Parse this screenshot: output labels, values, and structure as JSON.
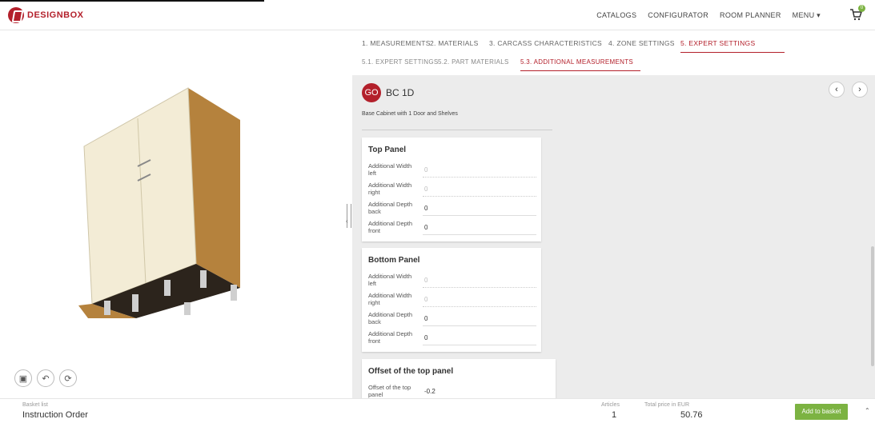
{
  "header": {
    "logo_text": "DESIGNBOX",
    "nav": [
      "CATALOGS",
      "CONFIGURATOR",
      "ROOM PLANNER",
      "MENU ▾"
    ],
    "cart_count": "0",
    "brand_color": "#b3202b"
  },
  "tabs_main": [
    "1. MEASUREMENTS",
    "2. MATERIALS",
    "3. CARCASS CHARACTERISTICS",
    "4. ZONE SETTINGS",
    "5. EXPERT SETTINGS"
  ],
  "tabs_sub": [
    "5.1. EXPERT SETTINGS",
    "5.2. PART MATERIALS",
    "5.3. ADDITIONAL MEASUREMENTS"
  ],
  "product": {
    "badge": "GO",
    "code": "BC 1D",
    "description": "Base Cabinet with 1 Door and Shelves"
  },
  "cards": {
    "top": {
      "title": "Top Panel",
      "rows": [
        {
          "label": "Additional Width left",
          "value": "0"
        },
        {
          "label": "Additional Width right",
          "value": "0"
        },
        {
          "label": "Additional Depth back",
          "value": "0"
        },
        {
          "label": "Additional Depth front",
          "value": "0"
        }
      ]
    },
    "bottom": {
      "title": "Bottom Panel",
      "rows": [
        {
          "label": "Additional Width left",
          "value": "0"
        },
        {
          "label": "Additional Width right",
          "value": "0"
        },
        {
          "label": "Additional Depth back",
          "value": "0"
        },
        {
          "label": "Additional Depth front",
          "value": "0"
        }
      ]
    },
    "offset": {
      "title": "Offset of the top panel",
      "rows": [
        {
          "label": "Offset of the top panel",
          "value": "-0.2"
        }
      ]
    }
  },
  "footer": {
    "basket_label": "Basket list",
    "basket_name": "Instruction Order",
    "articles_label": "Articles",
    "articles_value": "1",
    "price_label": "Total price in EUR",
    "price_value": "50.76",
    "add_button": "Add to basket",
    "accent": "#7cb342"
  }
}
